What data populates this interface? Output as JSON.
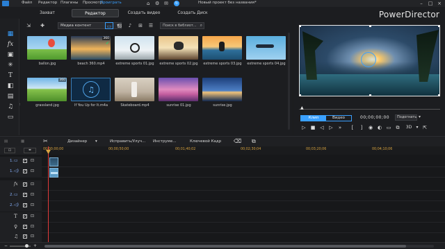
{
  "menu": {
    "items": [
      "Файл",
      "Редактор",
      "Плагины",
      "Просмотр",
      "Проиграть"
    ],
    "active_index": 4,
    "project_title": "Новый проект без названия*"
  },
  "tabs": {
    "capture": "Захват",
    "editor": "Редактор",
    "create_video": "Создать видео",
    "create_disc": "Создать Диск",
    "brand": "PowerDirector"
  },
  "library": {
    "media_filter": "Медиа контент",
    "search_placeholder": "Поиск в библиот...",
    "items": [
      {
        "name": "ballon.jpg",
        "badge": "",
        "check": false
      },
      {
        "name": "beach 360.mp4",
        "badge": "360",
        "check": true
      },
      {
        "name": "extreme sports 01.jpg",
        "badge": "",
        "check": false
      },
      {
        "name": "extreme sports 02.jpg",
        "badge": "",
        "check": false
      },
      {
        "name": "extreme sports 03.jpg",
        "badge": "",
        "check": false
      },
      {
        "name": "extreme sports 04.jpg",
        "badge": "",
        "check": false
      },
      {
        "name": "grassland.jpg",
        "badge": "360",
        "check": false
      },
      {
        "name": "If You Up for It.m4a",
        "badge": "",
        "check": false
      },
      {
        "name": "Skateboard.mp4",
        "badge": "",
        "check": false
      },
      {
        "name": "sunrise 01.jpg",
        "badge": "",
        "check": false
      },
      {
        "name": "sunrise.jpg",
        "badge": "",
        "check": false
      }
    ]
  },
  "preview": {
    "clip_label": "Клип",
    "movie_label": "Видео",
    "timecode": "00;00;00;00",
    "fit_label": "Подогнать",
    "mode_3d": "3D"
  },
  "timeline_toolbar": {
    "designer": "Дизайнер",
    "fix_enhance": "Исправить/Улуч...",
    "tools": "Инструме...",
    "keyframe": "Ключевой Кадр"
  },
  "ruler": {
    "times": [
      "00;00;00;00",
      "00;00;50;00",
      "00;01;40;02",
      "00;02;30;04",
      "00;03;20;06",
      "00;04;10;06"
    ]
  },
  "tracks": [
    {
      "label": "1.",
      "icon": "video-icon"
    },
    {
      "label": "1.",
      "icon": "audio-icon"
    },
    {
      "label": "",
      "icon": "fx-icon"
    },
    {
      "label": "2.",
      "icon": "video-icon"
    },
    {
      "label": "2.",
      "icon": "audio-icon"
    },
    {
      "label": "",
      "icon": "title-icon"
    },
    {
      "label": "",
      "icon": "voice-icon"
    },
    {
      "label": "",
      "icon": "music-icon"
    }
  ],
  "colors": {
    "accent": "#3aa0ff",
    "ruler_text": "#d9a441",
    "playhead": "#e23a3a"
  }
}
